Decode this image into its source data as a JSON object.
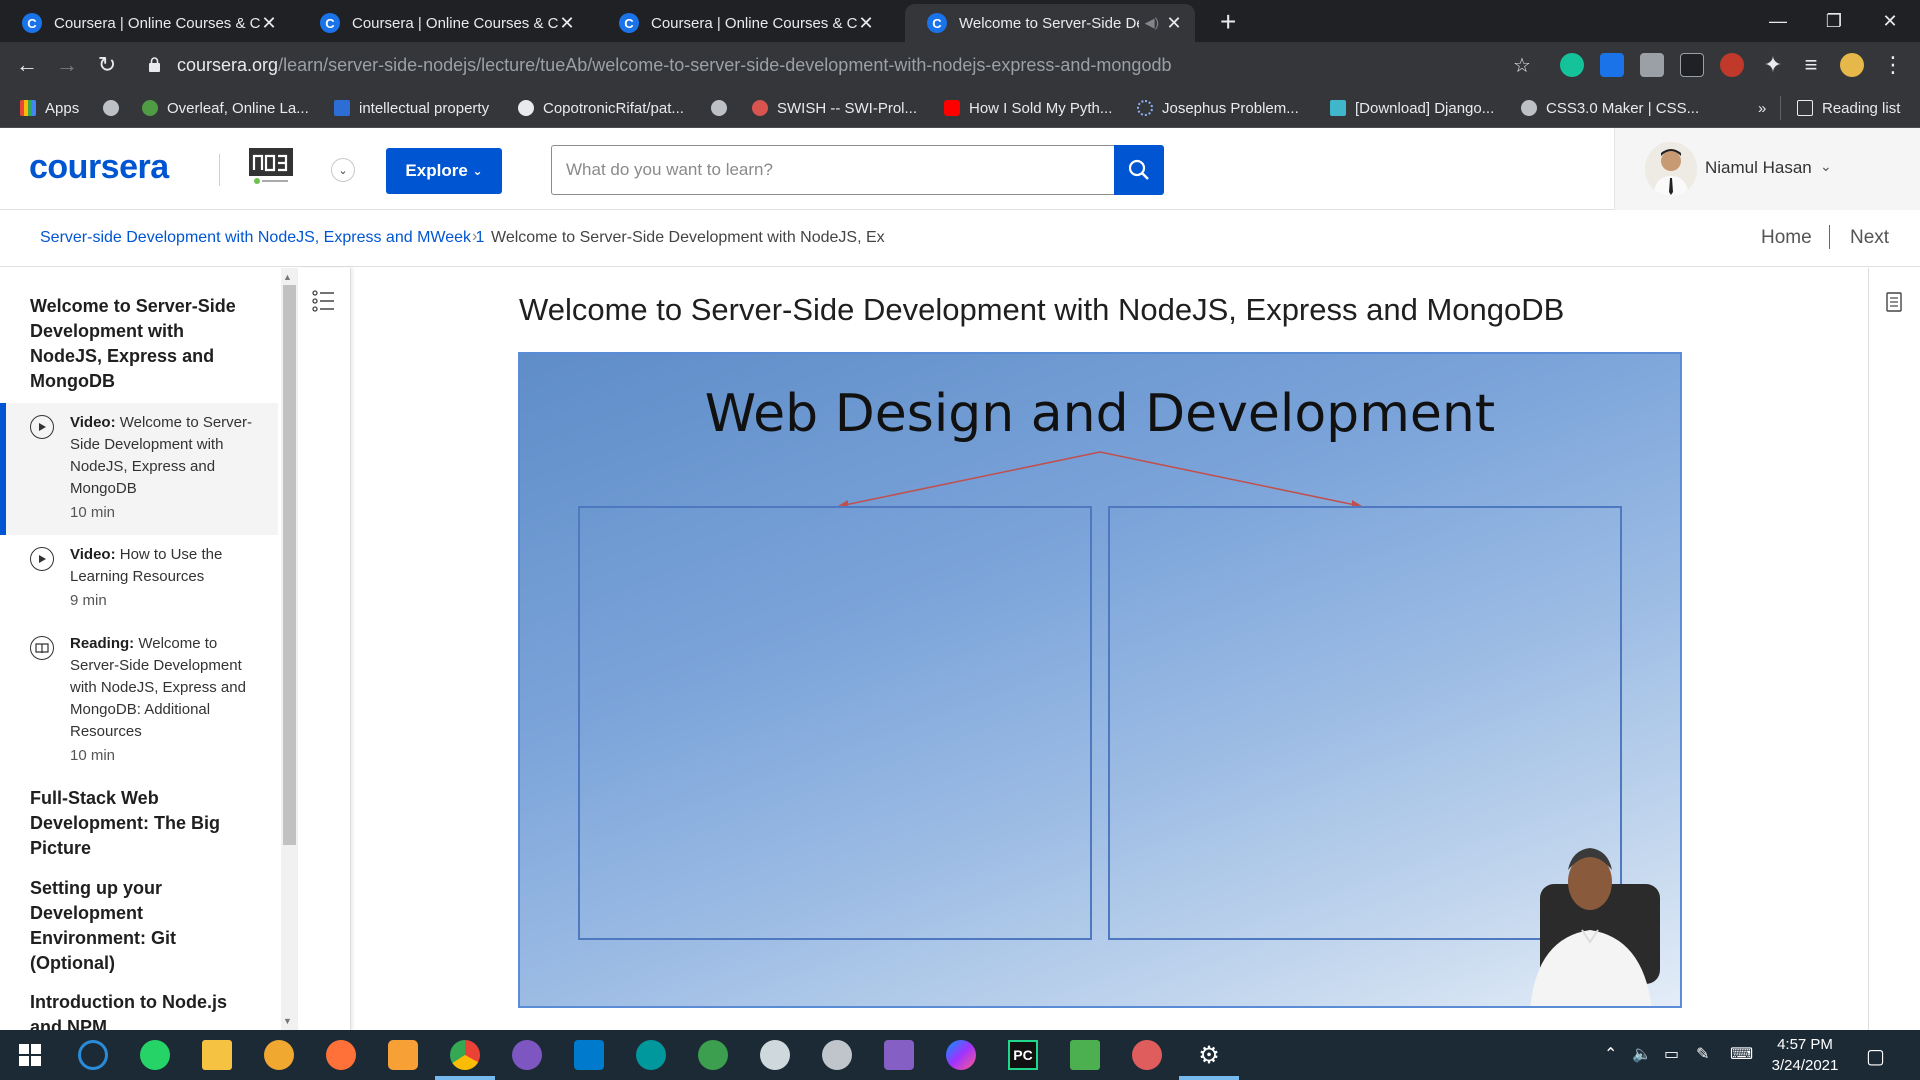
{
  "browser": {
    "tabs": [
      {
        "title": "Coursera | Online Courses & Credentials",
        "active": false
      },
      {
        "title": "Coursera | Online Courses & Credentials",
        "active": false
      },
      {
        "title": "Coursera | Online Courses & Credentials",
        "active": false
      },
      {
        "title": "Welcome to Server-Side Development",
        "active": true
      }
    ],
    "url_host": "coursera.org",
    "url_path": "/learn/server-side-nodejs/lecture/tueAb/welcome-to-server-side-development-with-nodejs-express-and-mongodb",
    "bookmarks": [
      {
        "label": "Apps",
        "icon": "apps-grid-icon",
        "color": "#e8453c"
      },
      {
        "label": "",
        "icon": "globe-icon",
        "color": "#bdc1c6"
      },
      {
        "label": "Overleaf, Online La...",
        "icon": "overleaf-icon",
        "color": "#4f9c45"
      },
      {
        "label": "intellectual property",
        "icon": "s-square-icon",
        "color": "#2d6ed6"
      },
      {
        "label": "CopotronicRifat/pat...",
        "icon": "github-icon",
        "color": "#e8eaed"
      },
      {
        "label": "",
        "icon": "globe-icon",
        "color": "#bdc1c6"
      },
      {
        "label": "SWISH -- SWI-Prol...",
        "icon": "swish-icon",
        "color": "#d9534f"
      },
      {
        "label": "How I Sold My Pyth...",
        "icon": "youtube-icon",
        "color": "#ff0000"
      },
      {
        "label": "Josephus Problem...",
        "icon": "loading-icon",
        "color": "#8ab4f8"
      },
      {
        "label": "[Download] Django...",
        "icon": "site-icon",
        "color": "#3fb6c9"
      },
      {
        "label": "CSS3.0 Maker | CSS...",
        "icon": "globe-icon",
        "color": "#bdc1c6"
      }
    ],
    "more_label": "»",
    "reading_list": "Reading list"
  },
  "header": {
    "logo": "coursera",
    "explore_label": "Explore",
    "search_placeholder": "What do you want to learn?",
    "user_name": "Niamul Hasan"
  },
  "breadcrumb": {
    "course": "Server-side Development with NodeJS, Express and MWeek 1",
    "separator": "›",
    "current": "Welcome to Server-Side Development with NodeJS, Ex",
    "home": "Home",
    "next": "Next"
  },
  "sidebar": {
    "module_title": "Welcome to Server-Side Development with NodeJS, Express and MongoDB",
    "items": [
      {
        "type": "Video:",
        "title": "Welcome to Server-Side Development with NodeJS, Express and MongoDB",
        "duration": "10 min",
        "active": true,
        "icon": "play-circle-icon"
      },
      {
        "type": "Video:",
        "title": "How to Use the Learning Resources",
        "duration": "9 min",
        "active": false,
        "icon": "play-circle-icon"
      },
      {
        "type": "Reading:",
        "title": "Welcome to Server-Side Development with NodeJS, Express and MongoDB: Additional Resources",
        "duration": "10 min",
        "active": false,
        "icon": "book-icon"
      }
    ],
    "sections": [
      "Full-Stack Web Development: The Big Picture",
      "Setting up your Development Environment: Git (Optional)",
      "Introduction to Node.js and NPM"
    ]
  },
  "main": {
    "lecture_title": "Welcome to Server-Side Development with NodeJS, Express and MongoDB",
    "slide_title": "Web Design and Development"
  },
  "taskbar": {
    "time": "4:57 PM",
    "date": "3/24/2021"
  },
  "colors": {
    "brand": "#0056d2",
    "chrome_dark": "#202124",
    "chrome_toolbar": "#35363a",
    "taskbar": "#1c2a36"
  }
}
